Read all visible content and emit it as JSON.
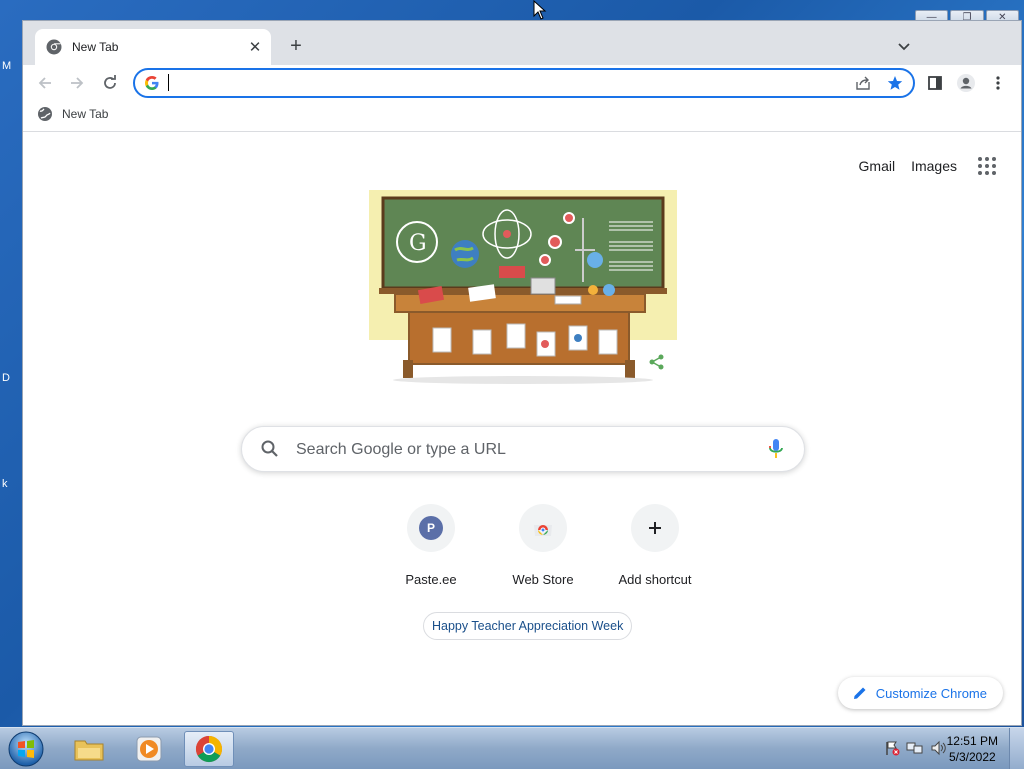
{
  "desktop": {
    "edge_letters": [
      "M",
      "D",
      "k"
    ]
  },
  "browser": {
    "tab": {
      "title": "New Tab",
      "close_glyph": "✕"
    },
    "new_tab_glyph": "+",
    "window_controls": [
      "—",
      "❐",
      "✕"
    ],
    "omnibox": {
      "value": "",
      "placeholder": ""
    },
    "bookmarks_bar": [
      {
        "label": "New Tab",
        "icon": "globe-icon"
      }
    ]
  },
  "page": {
    "top_links": {
      "gmail": "Gmail",
      "images": "Images"
    },
    "search": {
      "placeholder": "Search Google or type a URL"
    },
    "shortcuts": [
      {
        "label": "Paste.ee",
        "icon_letter": "P",
        "icon_color": "#5b6fa8"
      },
      {
        "label": "Web Store",
        "icon": "webstore-icon"
      },
      {
        "label": "Add shortcut",
        "icon": "plus-icon"
      }
    ],
    "doodle_link": "Happy Teacher Appreciation Week",
    "customize_label": "Customize Chrome"
  },
  "taskbar": {
    "time": "12:51 PM",
    "date": "5/3/2022",
    "apps": [
      "file-explorer-icon",
      "media-player-icon",
      "chrome-icon"
    ]
  },
  "colors": {
    "accent": "#1a73e8",
    "tab_strip": "#dee1e6"
  }
}
